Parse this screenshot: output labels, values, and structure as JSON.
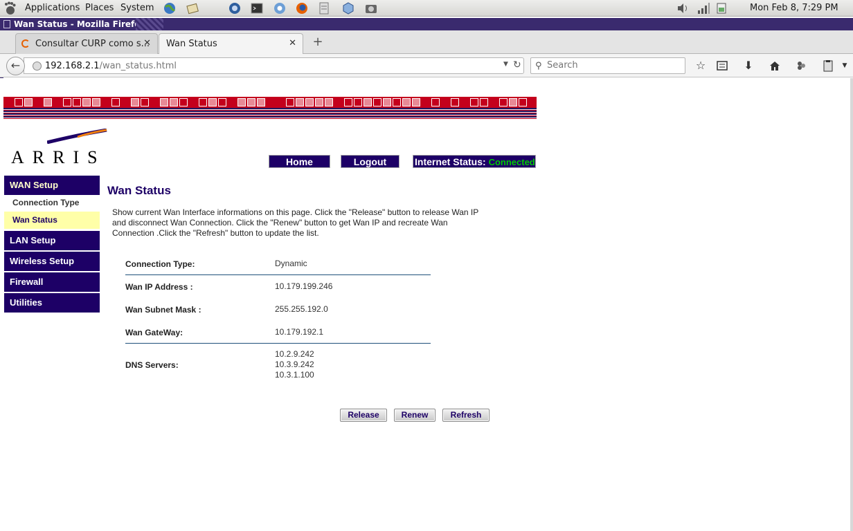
{
  "panel": {
    "menus": [
      "Applications",
      "Places",
      "System"
    ],
    "clock": "Mon Feb  8,  7:29 PM"
  },
  "window": {
    "title": "Wan Status - Mozilla Firefox"
  },
  "tabs": [
    {
      "label": "Consultar CURP como s...",
      "active": false
    },
    {
      "label": "Wan Status",
      "active": true
    }
  ],
  "browser": {
    "url_host": "192.168.2.1",
    "url_path": "/wan_status.html",
    "search_placeholder": "Search"
  },
  "router": {
    "brand": "ARRIS",
    "home_label": "Home",
    "logout_label": "Logout",
    "internet_status_label": "Internet Status:",
    "internet_status_value": "Connected",
    "sidebar": {
      "wan_setup": "WAN Setup",
      "connection_type": "Connection Type",
      "wan_status": "Wan Status",
      "lan_setup": "LAN Setup",
      "wireless_setup": "Wireless Setup",
      "firewall": "Firewall",
      "utilities": "Utilities"
    },
    "page_title": "Wan Status",
    "description": "Show current Wan Interface informations on this page. Click the \"Release\" button to release Wan IP and disconnect Wan Connection. Click the \"Renew\" button to get Wan IP and recreate Wan Connection .Click the \"Refresh\" button to update the list.",
    "rows": {
      "connection_type_label": "Connection Type:",
      "connection_type_value": "Dynamic",
      "wan_ip_label": "Wan IP Address :",
      "wan_ip_value": "10.179.199.246",
      "subnet_label": "Wan Subnet Mask :",
      "subnet_value": "255.255.192.0",
      "gateway_label": "Wan GateWay:",
      "gateway_value": "10.179.192.1",
      "dns_label": "DNS Servers:",
      "dns_values": [
        "10.2.9.242",
        "10.3.9.242",
        "10.3.1.100"
      ]
    },
    "buttons": {
      "release": "Release",
      "renew": "Renew",
      "refresh": "Refresh"
    }
  },
  "colors": {
    "router_navy": "#1d0066",
    "banner_red": "#c4001c",
    "connected_green": "#00cc00",
    "selected_yellow": "#ffffa8"
  }
}
